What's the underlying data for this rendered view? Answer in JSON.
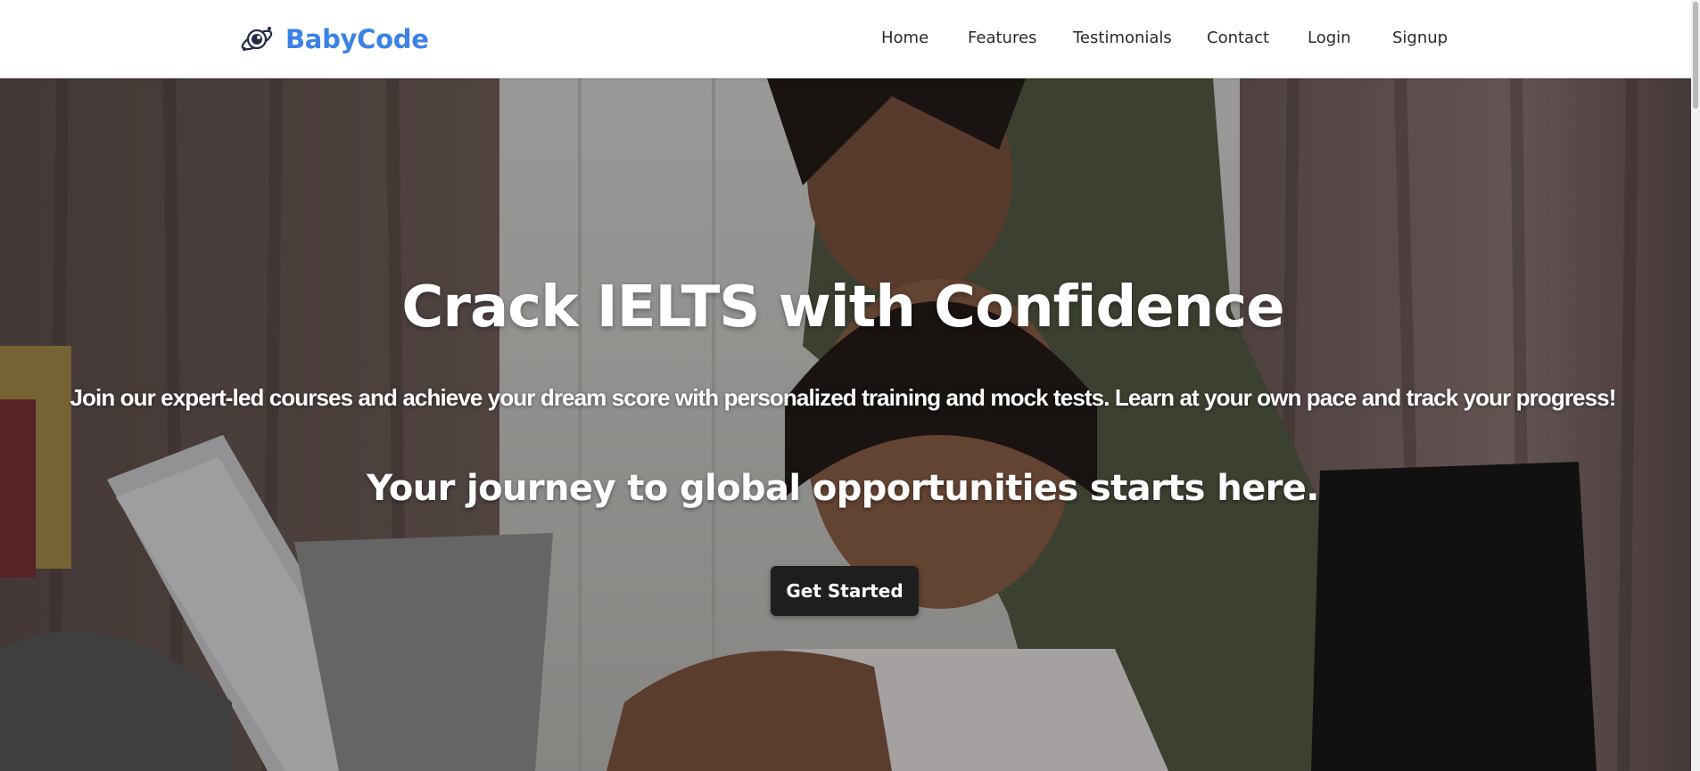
{
  "brand": {
    "name": "BabyCode",
    "logo_icon": "planet-astronaut-icon",
    "color": "#3b82e6"
  },
  "nav": {
    "items": [
      {
        "label": "Home"
      },
      {
        "label": "Features"
      },
      {
        "label": "Testimonials"
      },
      {
        "label": "Contact"
      },
      {
        "label": "Login"
      },
      {
        "label": "Signup"
      }
    ]
  },
  "hero": {
    "title": "Crack IELTS with Confidence",
    "subtitle": "Join our expert-led courses and achieve your dream score with personalized training and mock tests. Learn at your own pace and track your progress!",
    "tagline": "Your journey to global opportunities starts here.",
    "cta_label": "Get Started",
    "background_image": "mother-helping-daughter-at-laptop-photo",
    "overlay_color": "#121212"
  }
}
